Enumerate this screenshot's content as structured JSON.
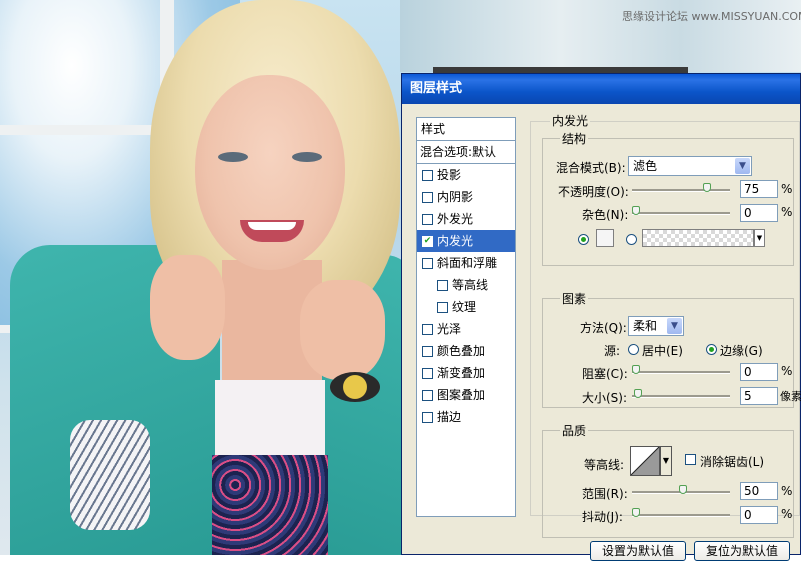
{
  "watermark": "思缘设计论坛 www.MISSYUAN.COM",
  "dialog": {
    "title": "图层样式",
    "styles_header": "样式",
    "blend_options": "混合选项:默认",
    "items": [
      {
        "label": "投影",
        "checked": false
      },
      {
        "label": "内阴影",
        "checked": false
      },
      {
        "label": "外发光",
        "checked": false
      },
      {
        "label": "内发光",
        "checked": true
      },
      {
        "label": "斜面和浮雕",
        "checked": false
      },
      {
        "label": "等高线",
        "checked": false
      },
      {
        "label": "纹理",
        "checked": false
      },
      {
        "label": "光泽",
        "checked": false
      },
      {
        "label": "颜色叠加",
        "checked": false
      },
      {
        "label": "渐变叠加",
        "checked": false
      },
      {
        "label": "图案叠加",
        "checked": false
      },
      {
        "label": "描边",
        "checked": false
      }
    ],
    "section_title": "内发光",
    "structure": {
      "title": "结构",
      "blend_mode_label": "混合模式(B):",
      "blend_mode_value": "滤色",
      "opacity_label": "不透明度(O):",
      "opacity_value": "75",
      "opacity_unit": "%",
      "opacity_fraction": 0.75,
      "noise_label": "杂色(N):",
      "noise_value": "0",
      "noise_unit": "%",
      "noise_fraction": 0.0
    },
    "elements": {
      "title": "图素",
      "technique_label": "方法(Q):",
      "technique_value": "柔和",
      "source_label": "源:",
      "center_label": "居中(E)",
      "edge_label": "边缘(G)",
      "source_selected": "edge",
      "choke_label": "阻塞(C):",
      "choke_value": "0",
      "choke_unit": "%",
      "choke_fraction": 0.0,
      "size_label": "大小(S):",
      "size_value": "5",
      "size_unit": "像素",
      "size_fraction": 0.02
    },
    "quality": {
      "title": "品质",
      "contour_label": "等高线:",
      "antialias_label": "消除锯齿(L)",
      "range_label": "范围(R):",
      "range_value": "50",
      "range_unit": "%",
      "range_fraction": 0.5,
      "jitter_label": "抖动(J):",
      "jitter_value": "0",
      "jitter_unit": "%",
      "jitter_fraction": 0.0
    },
    "buttons": {
      "make_default": "设置为默认值",
      "reset_default": "复位为默认值"
    },
    "colors": {
      "title_bar": "#0a58d6",
      "selection": "#316ac5",
      "dialog_bg": "#ece9d8"
    }
  }
}
